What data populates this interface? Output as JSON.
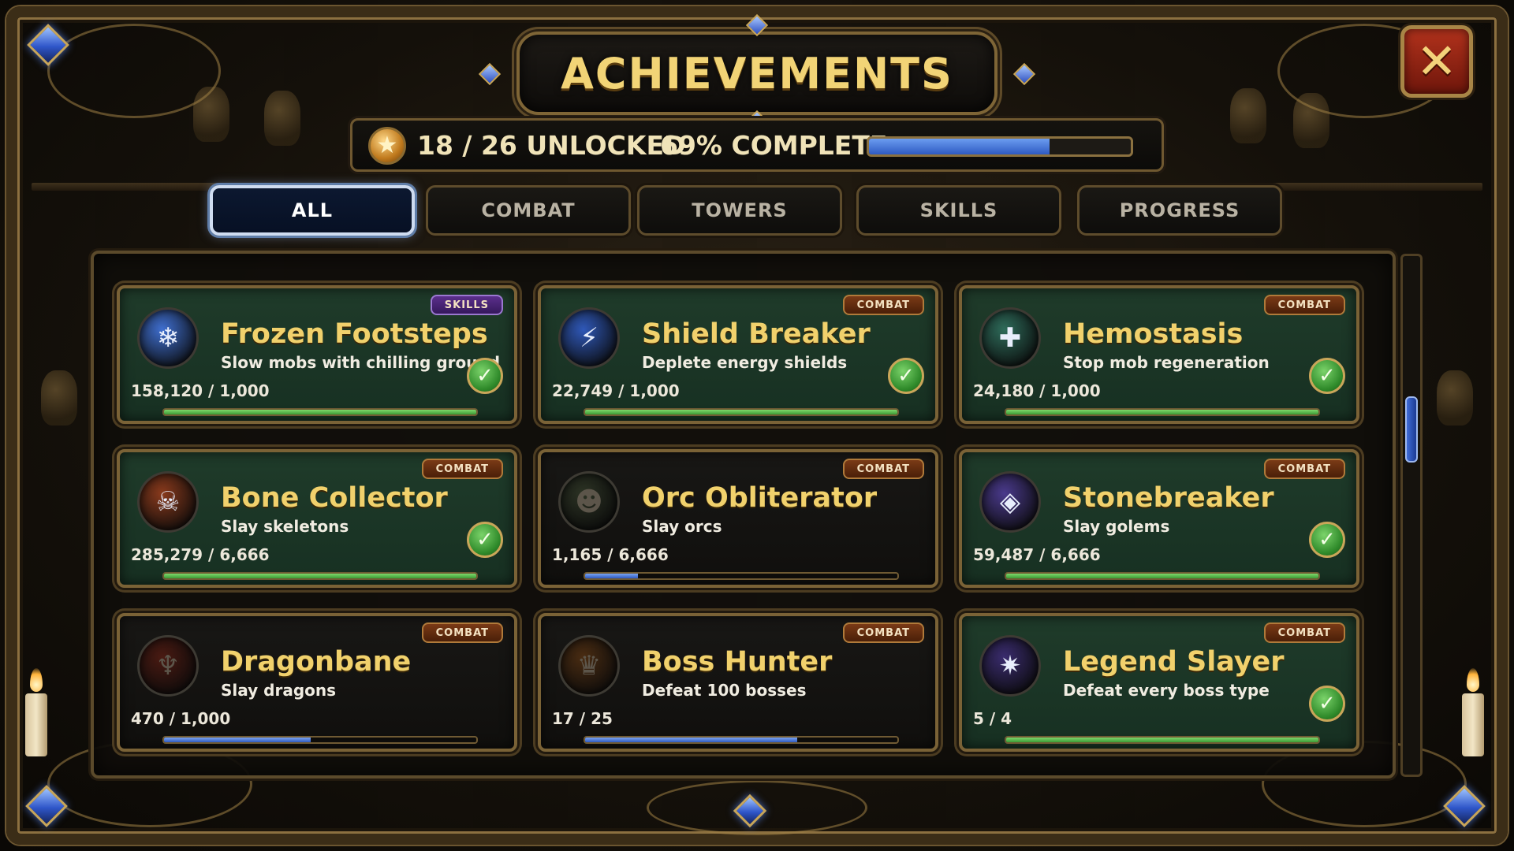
{
  "title": "ACHIEVEMENTS",
  "close_symbol": "✕",
  "summary": {
    "star_symbol": "★",
    "unlocked_text": "18 / 26 UNLOCKED",
    "complete_text": "69% COMPLETE",
    "progress_fraction": 0.69
  },
  "tabs": [
    {
      "label": "ALL",
      "active": true
    },
    {
      "label": "COMBAT",
      "active": false
    },
    {
      "label": "TOWERS",
      "active": false
    },
    {
      "label": "SKILLS",
      "active": false
    },
    {
      "label": "PROGRESS",
      "active": false
    }
  ],
  "colors": {
    "title_gold": "#f2d476",
    "card_unlocked_bg": "#1f3b2a",
    "card_locked_bg": "#181715",
    "progress_green": "#5fbf50",
    "progress_blue": "#4b78d8",
    "combat_badge": "#7a3a16",
    "skills_badge": "#5b2f8c"
  },
  "achievements": [
    {
      "title": "Frozen Footsteps",
      "description": "Slow mobs with chilling ground",
      "progress_text": "158,120 / 1,000",
      "progress_fraction": 1.0,
      "category": "SKILLS",
      "unlocked": true,
      "icon": "frost-vortex-icon",
      "icon_symbol": "❄",
      "icon_color": "#3f6fd0"
    },
    {
      "title": "Shield Breaker",
      "description": "Deplete energy shields",
      "progress_text": "22,749 / 1,000",
      "progress_fraction": 1.0,
      "category": "COMBAT",
      "unlocked": true,
      "icon": "lightning-shield-icon",
      "icon_symbol": "⚡",
      "icon_color": "#2f58b8"
    },
    {
      "title": "Hemostasis",
      "description": "Stop mob regeneration",
      "progress_text": "24,180 / 1,000",
      "progress_fraction": 1.0,
      "category": "COMBAT",
      "unlocked": true,
      "icon": "blocked-cross-icon",
      "icon_symbol": "✚",
      "icon_color": "#2e6b5a"
    },
    {
      "title": "Bone Collector",
      "description": "Slay skeletons",
      "progress_text": "285,279 / 6,666",
      "progress_fraction": 1.0,
      "category": "COMBAT",
      "unlocked": true,
      "icon": "skull-icon",
      "icon_symbol": "☠",
      "icon_color": "#8a3a1c"
    },
    {
      "title": "Orc Obliterator",
      "description": "Slay orcs",
      "progress_text": "1,165 / 6,666",
      "progress_fraction": 0.17,
      "category": "COMBAT",
      "unlocked": false,
      "icon": "orc-head-icon",
      "icon_symbol": "☻",
      "icon_color": "#2c3324"
    },
    {
      "title": "Stonebreaker",
      "description": "Slay golems",
      "progress_text": "59,487 / 6,666",
      "progress_fraction": 1.0,
      "category": "COMBAT",
      "unlocked": true,
      "icon": "golem-face-icon",
      "icon_symbol": "◈",
      "icon_color": "#4a3a8c"
    },
    {
      "title": "Dragonbane",
      "description": "Slay dragons",
      "progress_text": "470 / 1,000",
      "progress_fraction": 0.47,
      "category": "COMBAT",
      "unlocked": false,
      "icon": "dragon-head-icon",
      "icon_symbol": "♆",
      "icon_color": "#4a1a12"
    },
    {
      "title": "Boss Hunter",
      "description": "Defeat 100 bosses",
      "progress_text": "17 / 25",
      "progress_fraction": 0.68,
      "category": "COMBAT",
      "unlocked": false,
      "icon": "crowned-skull-icon",
      "icon_symbol": "♛",
      "icon_color": "#4a2c12"
    },
    {
      "title": "Legend Slayer",
      "description": "Defeat every boss type",
      "progress_text": "5 / 4",
      "progress_fraction": 1.0,
      "category": "COMBAT",
      "unlocked": true,
      "icon": "boss-collage-icon",
      "icon_symbol": "✷",
      "icon_color": "#3a2c6e"
    }
  ]
}
